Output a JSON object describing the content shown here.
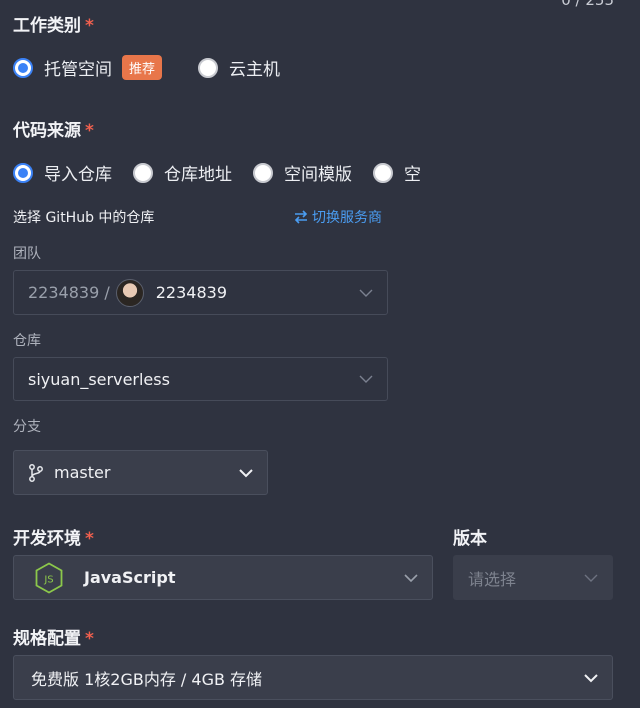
{
  "counter": "0 / 255",
  "work_type": {
    "title": "工作类别",
    "options": [
      {
        "label": "托管空间",
        "badge": "推荐",
        "checked": true
      },
      {
        "label": "云主机",
        "checked": false
      }
    ]
  },
  "code_source": {
    "title": "代码来源",
    "options": [
      {
        "label": "导入仓库",
        "checked": true
      },
      {
        "label": "仓库地址",
        "checked": false
      },
      {
        "label": "空间模版",
        "checked": false
      },
      {
        "label": "空",
        "checked": false
      }
    ],
    "repo_hint": "选择 GitHub 中的仓库",
    "switch_link": "切换服务商",
    "team": {
      "label": "团队",
      "prefix": "2234839 /",
      "value": "2234839"
    },
    "repo": {
      "label": "仓库",
      "value": "siyuan_serverless"
    },
    "branch": {
      "label": "分支",
      "value": "master"
    }
  },
  "dev_env": {
    "title": "开发环境",
    "value": "JavaScript",
    "icon": "nodejs-icon"
  },
  "version": {
    "title": "版本",
    "placeholder": "请选择"
  },
  "spec": {
    "title": "规格配置",
    "value": "免费版 1核2GB内存 / 4GB 存储"
  },
  "colors": {
    "background": "#2f3340",
    "accent": "#3b82f6",
    "required": "#f0604e",
    "badge": "#e8764a",
    "link": "#4a9cf0"
  }
}
